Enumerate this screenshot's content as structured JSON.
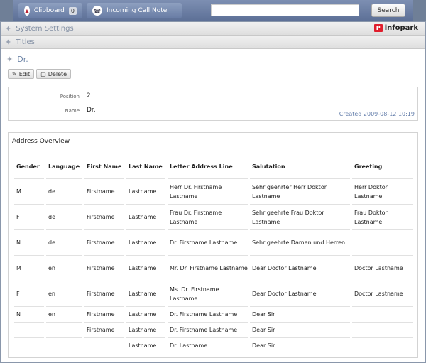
{
  "topbar": {
    "clipboard_label": "Clipboard",
    "clipboard_count": "0",
    "incoming_call_label": "Incoming Call Note",
    "search_placeholder": "",
    "search_button": "Search"
  },
  "sections": {
    "system_settings": "System Settings",
    "titles": "Titles"
  },
  "brand": {
    "logo_text": "infopark",
    "logo_mark": "P",
    "accent": "#e01d2c"
  },
  "record": {
    "title": "Dr.",
    "edit_label": "Edit",
    "delete_label": "Delete",
    "position_label": "Position",
    "position_value": "2",
    "name_label": "Name",
    "name_value": "Dr.",
    "created": "Created 2009-08-12 10:19"
  },
  "address_overview": {
    "title": "Address Overview",
    "columns": [
      "Gender",
      "Language",
      "First Name",
      "Last Name",
      "Letter Address Line",
      "Salutation",
      "Greeting"
    ],
    "rows": [
      [
        "M",
        "de",
        "Firstname",
        "Lastname",
        "Herr Dr. Firstname Lastname",
        "Sehr geehrter Herr Doktor Lastname",
        "Herr Doktor Lastname"
      ],
      [
        "F",
        "de",
        "Firstname",
        "Lastname",
        "Frau Dr. Firstname Lastname",
        "Sehr geehrte Frau Doktor Lastname",
        "Frau Doktor Lastname"
      ],
      [
        "N",
        "de",
        "Firstname",
        "Lastname",
        "Dr. Firstname Lastname",
        "Sehr geehrte Damen und Herren",
        ""
      ],
      [
        "M",
        "en",
        "Firstname",
        "Lastname",
        "Mr. Dr. Firstname Lastname",
        "Dear Doctor Lastname",
        "Doctor Lastname"
      ],
      [
        "F",
        "en",
        "Firstname",
        "Lastname",
        "Ms. Dr. Firstname Lastname",
        "Dear Doctor Lastname",
        "Doctor Lastname"
      ],
      [
        "N",
        "en",
        "Firstname",
        "Lastname",
        "Dr. Firstname Lastname",
        "Dear Sir",
        ""
      ],
      [
        "",
        "",
        "Firstname",
        "Lastname",
        "Dr. Firstname Lastname",
        "Dear Sir",
        ""
      ],
      [
        "",
        "",
        "",
        "Lastname",
        "Dr. Lastname",
        "Dear Sir",
        ""
      ]
    ]
  },
  "icons": {
    "clipboard": "clipboard-icon",
    "phone": "phone-icon",
    "brush": "brush-icon",
    "edit": "pencil-icon",
    "delete": "trash-icon"
  }
}
